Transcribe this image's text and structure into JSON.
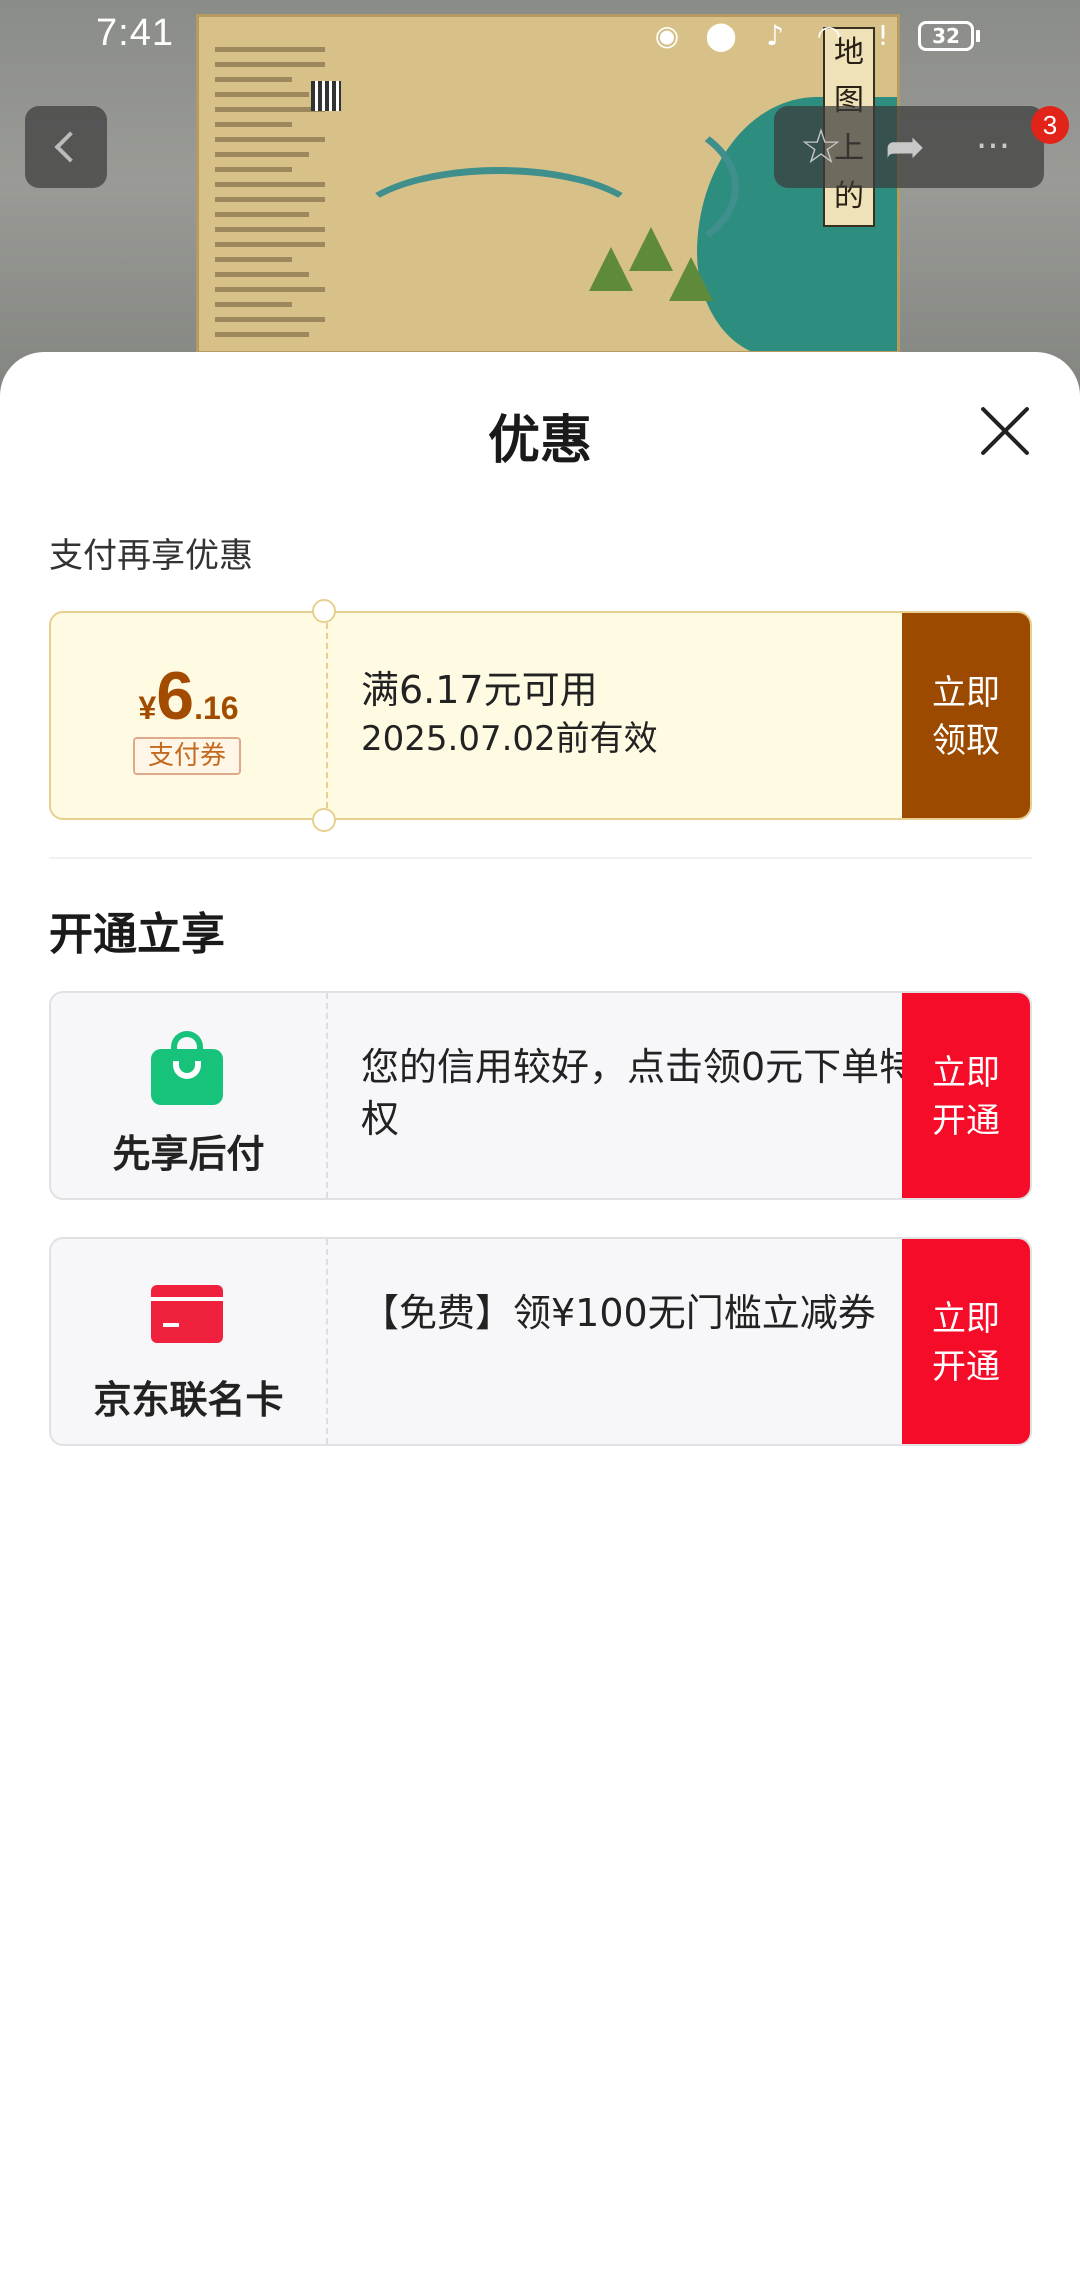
{
  "status_bar": {
    "time": "7:41",
    "battery": "32",
    "icons": [
      "eye-icon",
      "location-icon",
      "bell-off-icon",
      "wifi-icon",
      "alert-icon",
      "battery-icon"
    ]
  },
  "product_header": {
    "map_title": "地图上的宋词",
    "notification_count": "3"
  },
  "sheet": {
    "title": "优惠",
    "pay_section_label": "支付再享优惠",
    "pay_coupon": {
      "currency": "¥",
      "amount_int": "6",
      "amount_dec": ".16",
      "tag": "支付券",
      "condition": "满6.17元可用",
      "validity": "2025.07.02前有效",
      "cta": "立即领取",
      "accent": "#9c4a00"
    },
    "offers_section_title": "开通立享",
    "offers": [
      {
        "name": "先享后付",
        "icon": "shopping-bag-icon",
        "description": "您的信用较好，点击领0元下单特权",
        "cta": "立即开通"
      },
      {
        "name": "京东联名卡",
        "icon": "credit-card-icon",
        "description": "【免费】领¥100无门槛立减券",
        "cta": "立即开通"
      }
    ],
    "cta_color": "#f50c29"
  }
}
